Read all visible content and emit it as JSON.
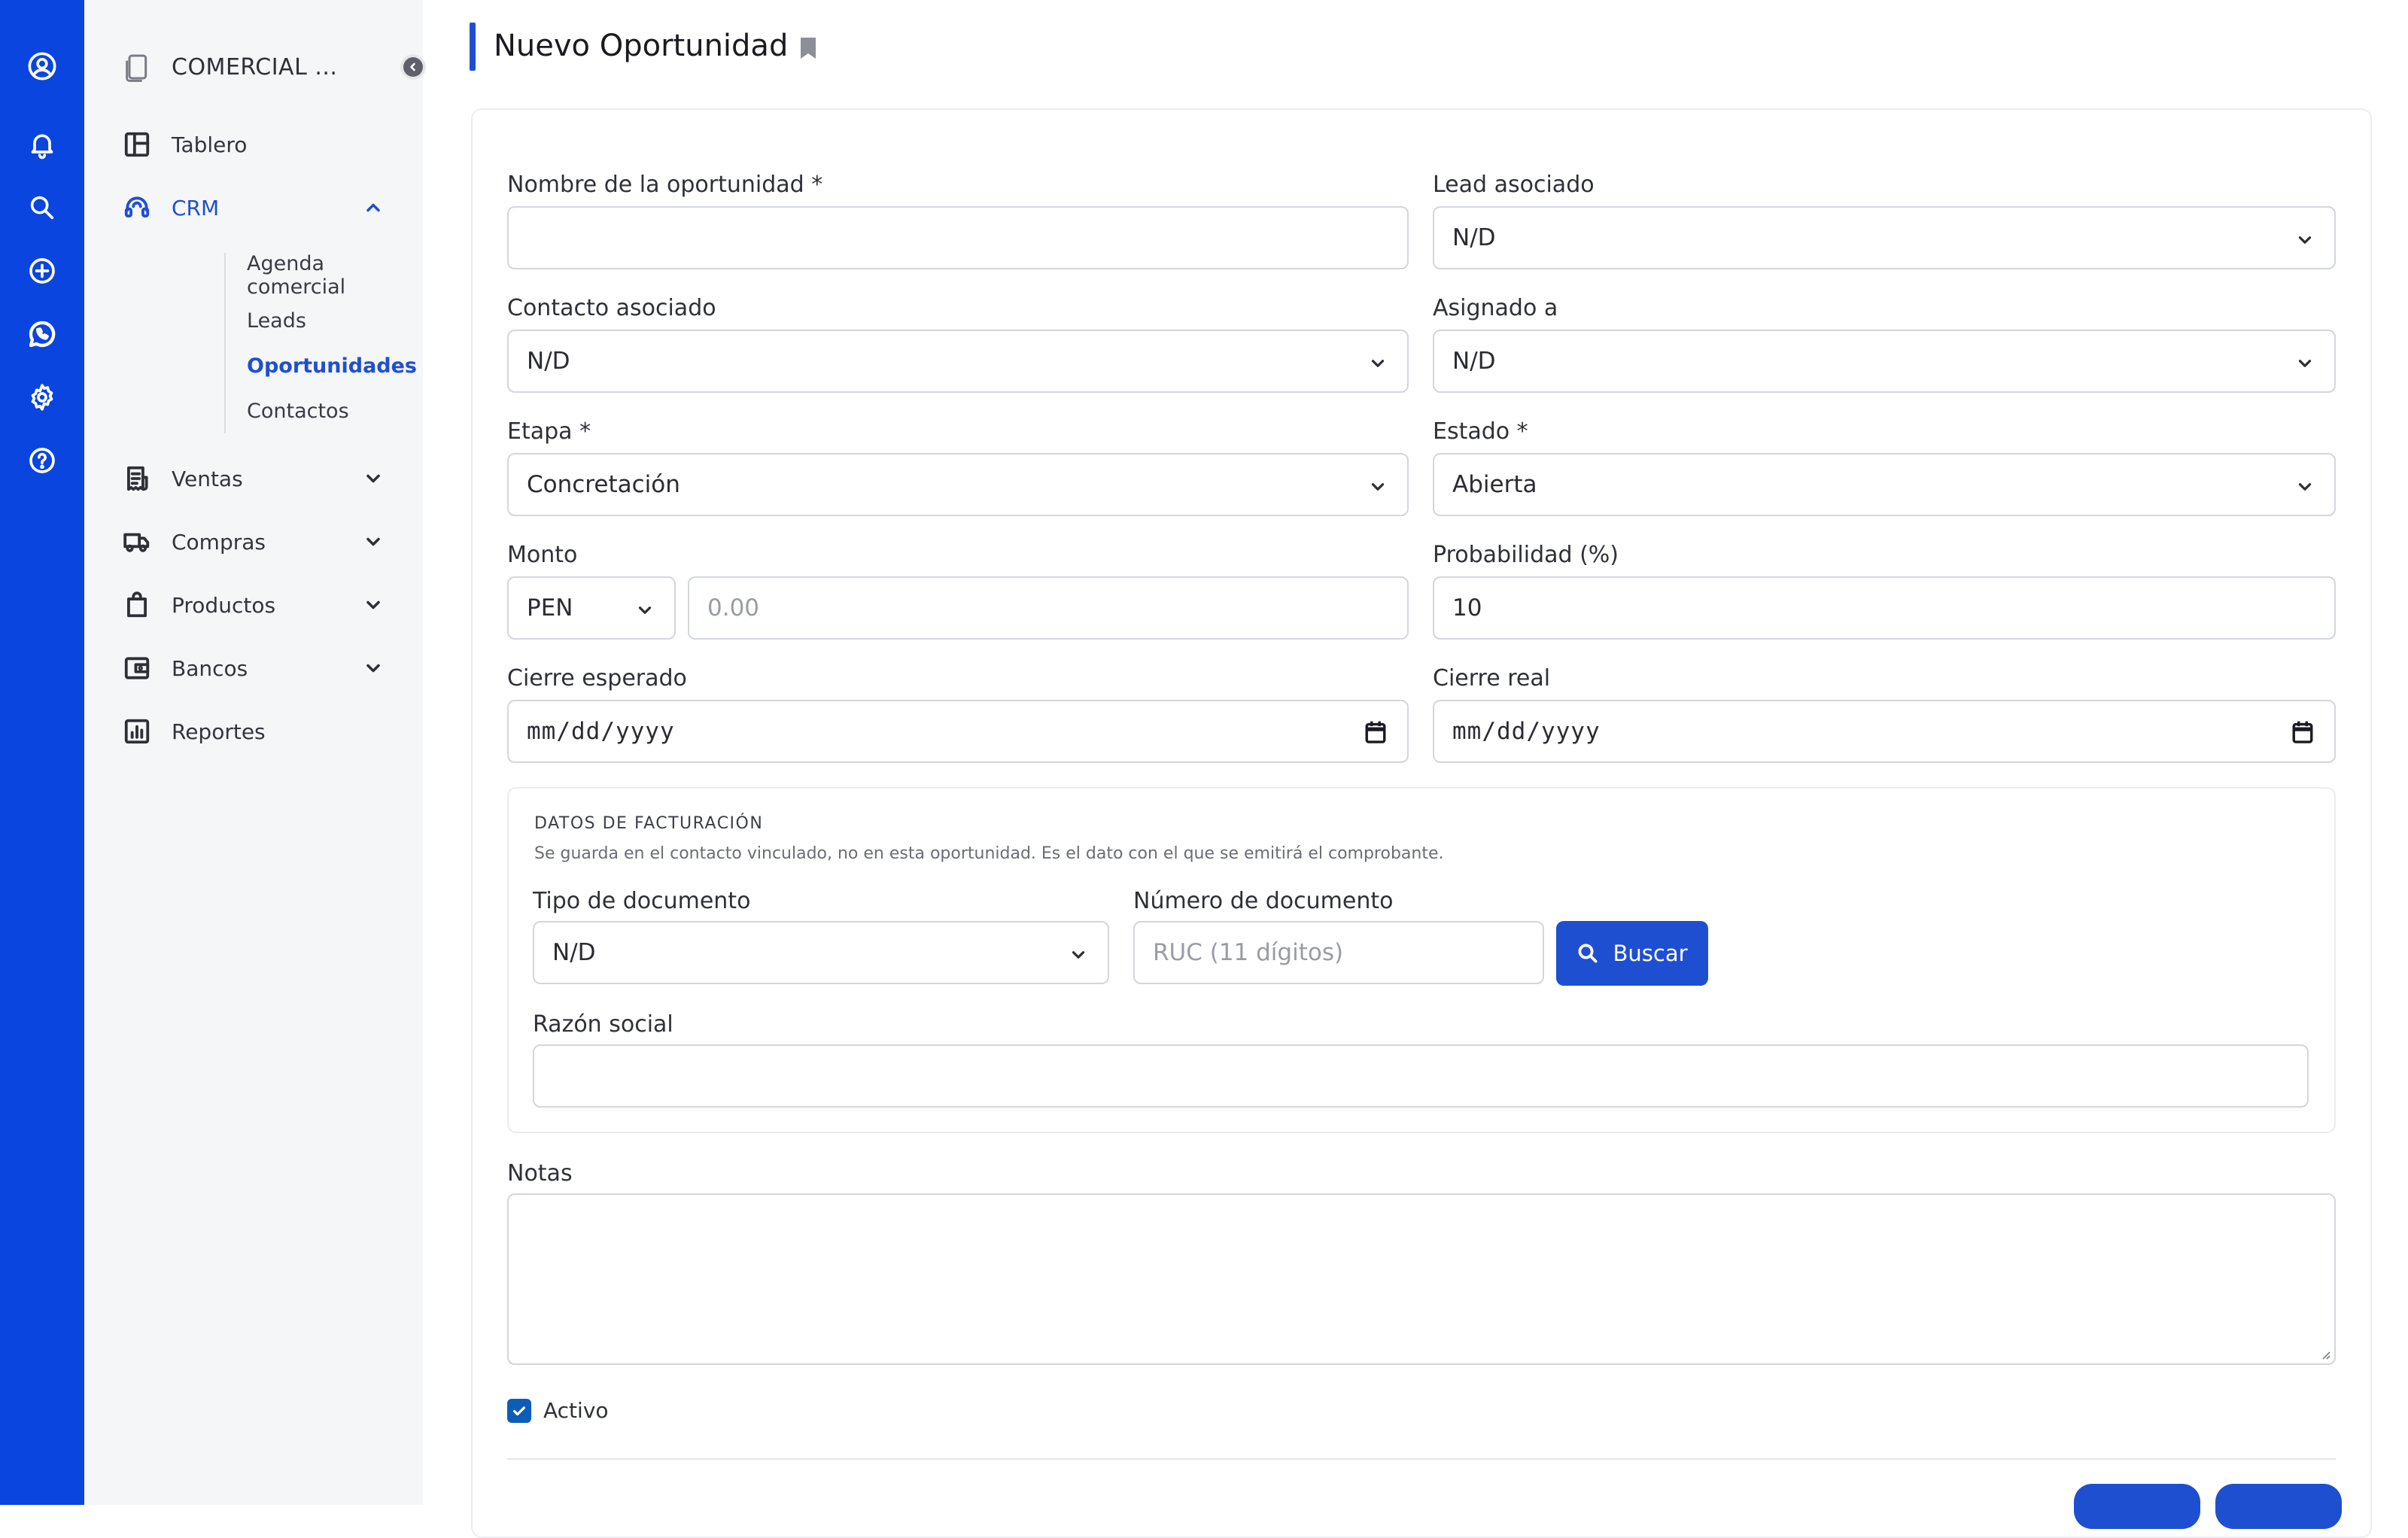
{
  "sidebar": {
    "company": "COMERCIAL ...",
    "nav": {
      "tablero": "Tablero",
      "crm": "CRM",
      "ventas": "Ventas",
      "compras": "Compras",
      "productos": "Productos",
      "bancos": "Bancos",
      "reportes": "Reportes"
    },
    "crm_sub": [
      "Agenda comercial",
      "Leads",
      "Oportunidades",
      "Contactos"
    ],
    "active_item": "Oportunidades"
  },
  "page": {
    "title": "Nuevo Oportunidad"
  },
  "form": {
    "nombre_label": "Nombre de la oportunidad *",
    "nombre_value": "",
    "lead_label": "Lead asociado",
    "lead_value": "N/D",
    "contacto_label": "Contacto asociado",
    "contacto_value": "N/D",
    "asignado_label": "Asignado a",
    "asignado_value": "N/D",
    "etapa_label": "Etapa *",
    "etapa_value": "Concretación",
    "estado_label": "Estado *",
    "estado_value": "Abierta",
    "monto_label": "Monto",
    "moneda_value": "PEN",
    "monto_placeholder": "0.00",
    "probabilidad_label": "Probabilidad (%)",
    "probabilidad_value": "10",
    "cierre_esperado_label": "Cierre esperado",
    "cierre_esperado_value": "mm/dd/yyyy",
    "cierre_real_label": "Cierre real",
    "cierre_real_value": "mm/dd/yyyy",
    "notas_label": "Notas",
    "notas_value": "",
    "activo_label": "Activo",
    "activo_checked": true
  },
  "billing": {
    "title": "DATOS DE FACTURACIÓN",
    "description": "Se guarda en el contacto vinculado, no en esta oportunidad. Es el dato con el que se emitirá el comprobante.",
    "tipo_doc_label": "Tipo de documento",
    "tipo_doc_value": "N/D",
    "num_doc_label": "Número de documento",
    "num_doc_placeholder": "RUC (11 dígitos)",
    "buscar_label": "Buscar",
    "razon_label": "Razón social",
    "razon_value": ""
  },
  "colors": {
    "rail": "#0a45e0",
    "accent": "#1f4fd1",
    "checkbox": "#0d5db8",
    "sidebar_bg": "#f5f6f8"
  },
  "icons": {
    "rail": [
      "user-circle-icon",
      "bell-icon",
      "search-icon",
      "plus-circle-icon",
      "whatsapp-icon",
      "gear-icon",
      "help-icon"
    ]
  }
}
